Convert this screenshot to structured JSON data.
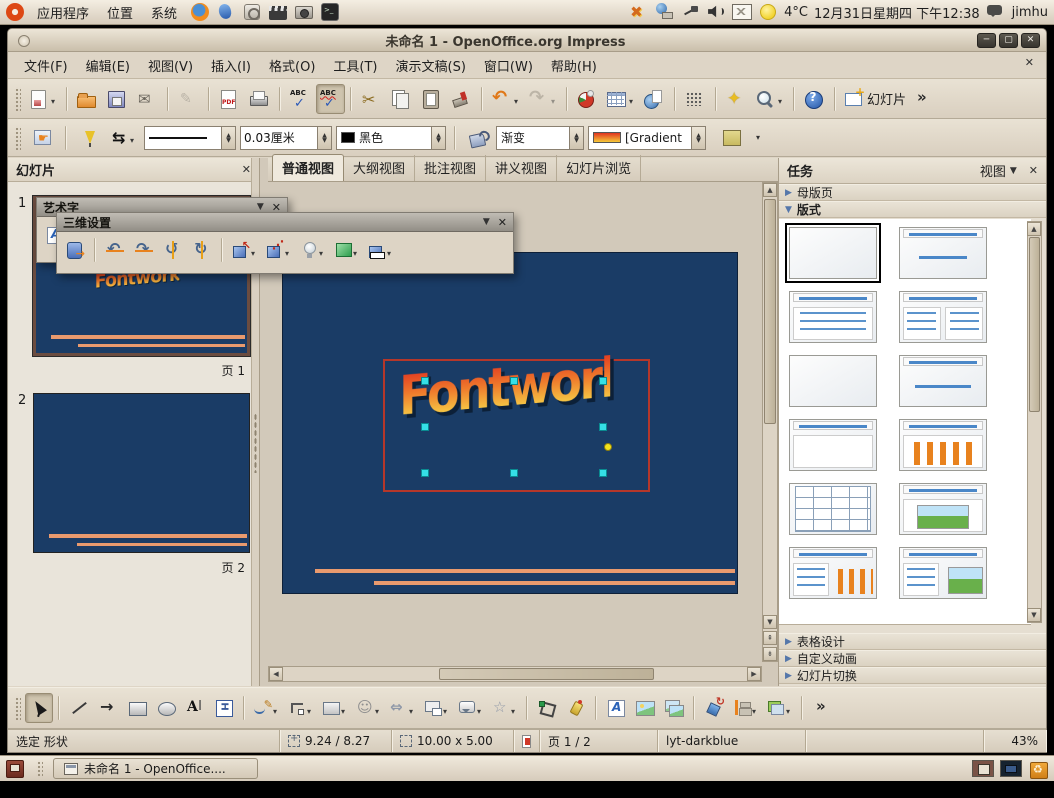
{
  "top_panel": {
    "menus": [
      {
        "name": "applications",
        "label": "应用程序"
      },
      {
        "name": "places",
        "label": "位置"
      },
      {
        "name": "system",
        "label": "系统"
      }
    ],
    "launchers": [
      {
        "name": "firefox"
      },
      {
        "name": "pidgin"
      },
      {
        "name": "rhythmbox"
      },
      {
        "name": "movie"
      },
      {
        "name": "camera"
      },
      {
        "name": "terminal"
      }
    ],
    "tray_icons": [
      {
        "name": "xchat"
      },
      {
        "name": "keyboard"
      },
      {
        "name": "power"
      },
      {
        "name": "volume"
      },
      {
        "name": "mail"
      }
    ],
    "tray": {
      "temperature": "4°C",
      "datetime": "12月31日星期四 下午12:38",
      "user": "jimhu"
    }
  },
  "window": {
    "title": "未命名 1 - OpenOffice.org Impress",
    "menubar": [
      {
        "name": "file",
        "label": "文件(F)"
      },
      {
        "name": "edit",
        "label": "编辑(E)"
      },
      {
        "name": "view",
        "label": "视图(V)"
      },
      {
        "name": "insert",
        "label": "插入(I)"
      },
      {
        "name": "format",
        "label": "格式(O)"
      },
      {
        "name": "tools",
        "label": "工具(T)"
      },
      {
        "name": "slideshow",
        "label": "演示文稿(S)"
      },
      {
        "name": "window",
        "label": "窗口(W)"
      },
      {
        "name": "help",
        "label": "帮助(H)"
      }
    ],
    "toolbar_main": [
      {
        "name": "new-presentation",
        "dd": true
      },
      {
        "sep": true
      },
      {
        "name": "open"
      },
      {
        "name": "save"
      },
      {
        "name": "email-document"
      },
      {
        "sep": true
      },
      {
        "name": "edit-file",
        "disabled": true
      },
      {
        "sep": true
      },
      {
        "name": "export-pdf"
      },
      {
        "name": "print"
      },
      {
        "sep": true
      },
      {
        "name": "spellcheck"
      },
      {
        "name": "auto-spellcheck",
        "active": true
      },
      {
        "sep": true
      },
      {
        "name": "cut"
      },
      {
        "name": "copy"
      },
      {
        "name": "paste"
      },
      {
        "name": "format-paintbrush"
      },
      {
        "sep": true
      },
      {
        "name": "undo",
        "dd": true
      },
      {
        "name": "redo",
        "dd": true,
        "disabled": true
      },
      {
        "sep": true
      },
      {
        "name": "chart"
      },
      {
        "name": "table",
        "dd": true
      },
      {
        "name": "hyperlink"
      },
      {
        "sep": true
      },
      {
        "name": "display-grid"
      },
      {
        "sep": true
      },
      {
        "name": "navigator"
      },
      {
        "name": "zoom",
        "dd": true
      },
      {
        "sep": true
      },
      {
        "name": "help"
      },
      {
        "sep": true
      },
      {
        "name": "slide-new",
        "label": "幻灯片"
      },
      {
        "name": "overflow"
      }
    ],
    "toolbar_line": {
      "line_width": "0.03厘米",
      "line_color": "黑色",
      "fill_type": "渐变",
      "fill_value": "[Gradient"
    },
    "view_tabs": [
      {
        "name": "normal-view",
        "label": "普通视图",
        "active": true
      },
      {
        "name": "outline-view",
        "label": "大纲视图"
      },
      {
        "name": "notes-view",
        "label": "批注视图"
      },
      {
        "name": "handout-view",
        "label": "讲义视图"
      },
      {
        "name": "slide-sorter-view",
        "label": "幻灯片浏览"
      }
    ],
    "slides_panel": {
      "title": "幻灯片",
      "slides": [
        {
          "num": "1",
          "page_label": "页 1",
          "text": "Fontwork",
          "selected": true
        },
        {
          "num": "2",
          "page_label": "页 2"
        }
      ]
    },
    "floating": {
      "fontwork": {
        "title": "艺术字"
      },
      "threed": {
        "title": "三维设置",
        "items": [
          {
            "name": "extrusion-toggle"
          },
          {
            "sep": true
          },
          {
            "name": "tilt-down"
          },
          {
            "name": "tilt-up"
          },
          {
            "name": "tilt-left"
          },
          {
            "name": "tilt-right"
          },
          {
            "sep": true
          },
          {
            "name": "depth",
            "dd": true,
            "cube": true
          },
          {
            "name": "direction",
            "dd": true,
            "cube": true
          },
          {
            "name": "lighting",
            "dd": true
          },
          {
            "name": "surface",
            "dd": true
          },
          {
            "name": "extrusion-color",
            "dd": true,
            "cube": true
          }
        ]
      }
    },
    "canvas": {
      "fontwork_text": "Fontwork."
    },
    "tasks": {
      "title": "任务",
      "view_label": "视图",
      "masters_label": "母版页",
      "layouts_label": "版式",
      "table_label": "表格设计",
      "animation_label": "自定义动画",
      "transition_label": "幻灯片切换",
      "layouts": [
        {
          "type": "blank",
          "selected": true
        },
        {
          "type": "title-sub"
        },
        {
          "type": "title-list"
        },
        {
          "type": "title-2col"
        },
        {
          "type": "white"
        },
        {
          "type": "title-center"
        },
        {
          "type": "title-box"
        },
        {
          "type": "title-chart"
        },
        {
          "type": "table"
        },
        {
          "type": "title-image"
        },
        {
          "type": "list-chart"
        },
        {
          "type": "list-image"
        }
      ]
    },
    "drawbar": [
      {
        "name": "select",
        "active": true
      },
      {
        "sep": true
      },
      {
        "name": "line"
      },
      {
        "name": "arrowline"
      },
      {
        "name": "rectangle"
      },
      {
        "name": "ellipse"
      },
      {
        "name": "text"
      },
      {
        "name": "vertical-text"
      },
      {
        "sep": true
      },
      {
        "name": "curve",
        "dd": true
      },
      {
        "name": "connector",
        "dd": true
      },
      {
        "name": "basic-shapes",
        "dd": true
      },
      {
        "name": "symbol-shapes",
        "dd": true
      },
      {
        "name": "block-arrows",
        "dd": true
      },
      {
        "name": "flowchart",
        "dd": true
      },
      {
        "name": "callouts",
        "dd": true
      },
      {
        "name": "stars",
        "dd": true
      },
      {
        "sep": true
      },
      {
        "name": "edit-points"
      },
      {
        "name": "glue-points"
      },
      {
        "sep": true
      },
      {
        "name": "fontwork-gallery"
      },
      {
        "name": "from-file"
      },
      {
        "name": "gallery"
      },
      {
        "sep": true
      },
      {
        "name": "rotate"
      },
      {
        "name": "alignment",
        "dd": true
      },
      {
        "name": "arrange",
        "dd": true
      },
      {
        "sep": true
      },
      {
        "name": "overflow"
      }
    ],
    "statusbar": {
      "info": "选定 形状",
      "position": "9.24 / 8.27",
      "size": "10.00 x 5.00",
      "page": "页 1 / 2",
      "template": "lyt-darkblue",
      "zoom": "43%"
    }
  },
  "taskbar": {
    "window_button": "未命名 1 - OpenOffice...."
  },
  "colors": {
    "slide_bg": "#1a3c66",
    "accent_orange": "#e99a6e",
    "frame_red": "#b5372a",
    "handle_cyan": "#35dfe6"
  }
}
